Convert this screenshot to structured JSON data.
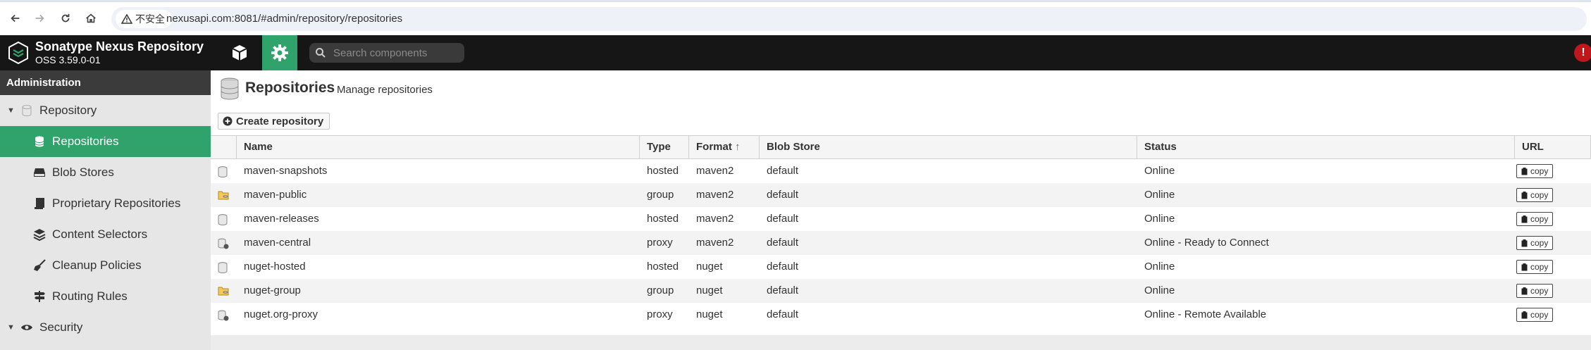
{
  "browser": {
    "security_label": "不安全",
    "url": "nexusapi.com:8081/#admin/repository/repositories"
  },
  "header": {
    "title": "Sonatype Nexus Repository",
    "version": "OSS 3.59.0-01",
    "search_placeholder": "Search components"
  },
  "sidebar": {
    "section_title": "Administration",
    "items": [
      {
        "label": "Repository",
        "icon": "database-icon"
      },
      {
        "label": "Repositories",
        "icon": "database-icon"
      },
      {
        "label": "Blob Stores",
        "icon": "hdd-icon"
      },
      {
        "label": "Proprietary Repositories",
        "icon": "book-icon"
      },
      {
        "label": "Content Selectors",
        "icon": "layers-icon"
      },
      {
        "label": "Cleanup Policies",
        "icon": "broom-icon"
      },
      {
        "label": "Routing Rules",
        "icon": "signpost-icon"
      },
      {
        "label": "Security",
        "icon": "eye-icon"
      }
    ]
  },
  "main": {
    "title": "Repositories",
    "subtitle": "Manage repositories",
    "create_button": "Create repository",
    "columns": [
      "Name",
      "Type",
      "Format",
      "Blob Store",
      "Status",
      "URL"
    ],
    "sort_indicator": "↑",
    "copy_label": "copy",
    "rows": [
      {
        "name": "maven-snapshots",
        "type": "hosted",
        "format": "maven2",
        "blob": "default",
        "status": "Online"
      },
      {
        "name": "maven-public",
        "type": "group",
        "format": "maven2",
        "blob": "default",
        "status": "Online"
      },
      {
        "name": "maven-releases",
        "type": "hosted",
        "format": "maven2",
        "blob": "default",
        "status": "Online"
      },
      {
        "name": "maven-central",
        "type": "proxy",
        "format": "maven2",
        "blob": "default",
        "status": "Online - Ready to Connect"
      },
      {
        "name": "nuget-hosted",
        "type": "hosted",
        "format": "nuget",
        "blob": "default",
        "status": "Online"
      },
      {
        "name": "nuget-group",
        "type": "group",
        "format": "nuget",
        "blob": "default",
        "status": "Online"
      },
      {
        "name": "nuget.org-proxy",
        "type": "proxy",
        "format": "nuget",
        "blob": "default",
        "status": "Online - Remote Available"
      }
    ]
  },
  "colors": {
    "accent_green": "#2fa36b",
    "header_bg": "#161616",
    "sidebar_bg": "#e6e6e6",
    "alert_red": "#c0161c"
  }
}
